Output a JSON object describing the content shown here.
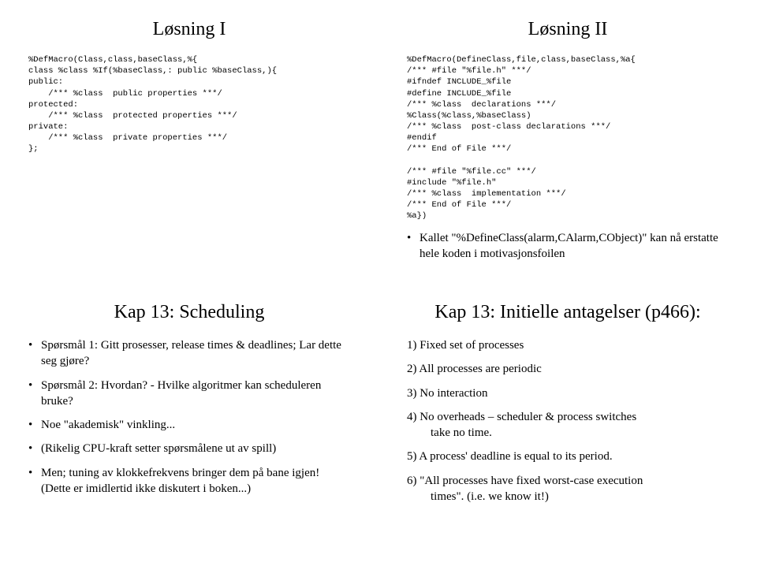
{
  "slide1": {
    "title": "Løsning I",
    "code": "%DefMacro(Class,class,baseClass,%{\nclass %class %If(%baseClass,: public %baseClass,){\npublic:\n    /*** %class  public properties ***/\nprotected:\n    /*** %class  protected properties ***/\nprivate:\n    /*** %class  private properties ***/\n};"
  },
  "slide2": {
    "title": "Løsning II",
    "code": "%DefMacro(DefineClass,file,class,baseClass,%a{\n/*** #file \"%file.h\" ***/\n#ifndef INCLUDE_%file\n#define INCLUDE_%file\n/*** %class  declarations ***/\n%Class(%class,%baseClass)\n/*** %class  post-class declarations ***/\n#endif\n/*** End of File ***/\n\n/*** #file \"%file.cc\" ***/\n#include \"%file.h\"\n/*** %class  implementation ***/\n/*** End of File ***/\n%a})",
    "bullet": "Kallet \"%DefineClass(alarm,CAlarm,CObject)\" kan nå erstatte hele koden i motivasjonsfoilen"
  },
  "slide3": {
    "title": "Kap 13: Scheduling",
    "bullets": [
      "Spørsmål 1: Gitt prosesser, release times & deadlines; Lar dette seg gjøre?",
      "Spørsmål 2: Hvordan? - Hvilke algoritmer kan scheduleren bruke?",
      "Noe \"akademisk\" vinkling...",
      "(Rikelig CPU-kraft setter spørsmålene ut av spill)",
      "Men; tuning av klokkefrekvens bringer dem på bane igjen! (Dette er imidlertid ikke diskutert i boken...)"
    ]
  },
  "slide4": {
    "title": "Kap 13: Initielle antagelser (p466):",
    "items": [
      {
        "text": "1) Fixed set of processes",
        "hang": ""
      },
      {
        "text": "2) All processes are periodic",
        "hang": ""
      },
      {
        "text": "3) No interaction",
        "hang": ""
      },
      {
        "text": "4) No overheads – scheduler & process switches",
        "hang": "take no time."
      },
      {
        "text": "5) A process' deadline is equal to its period.",
        "hang": ""
      },
      {
        "text": "6) \"All processes have fixed worst-case execution",
        "hang": "times\". (i.e. we know it!)"
      }
    ]
  }
}
